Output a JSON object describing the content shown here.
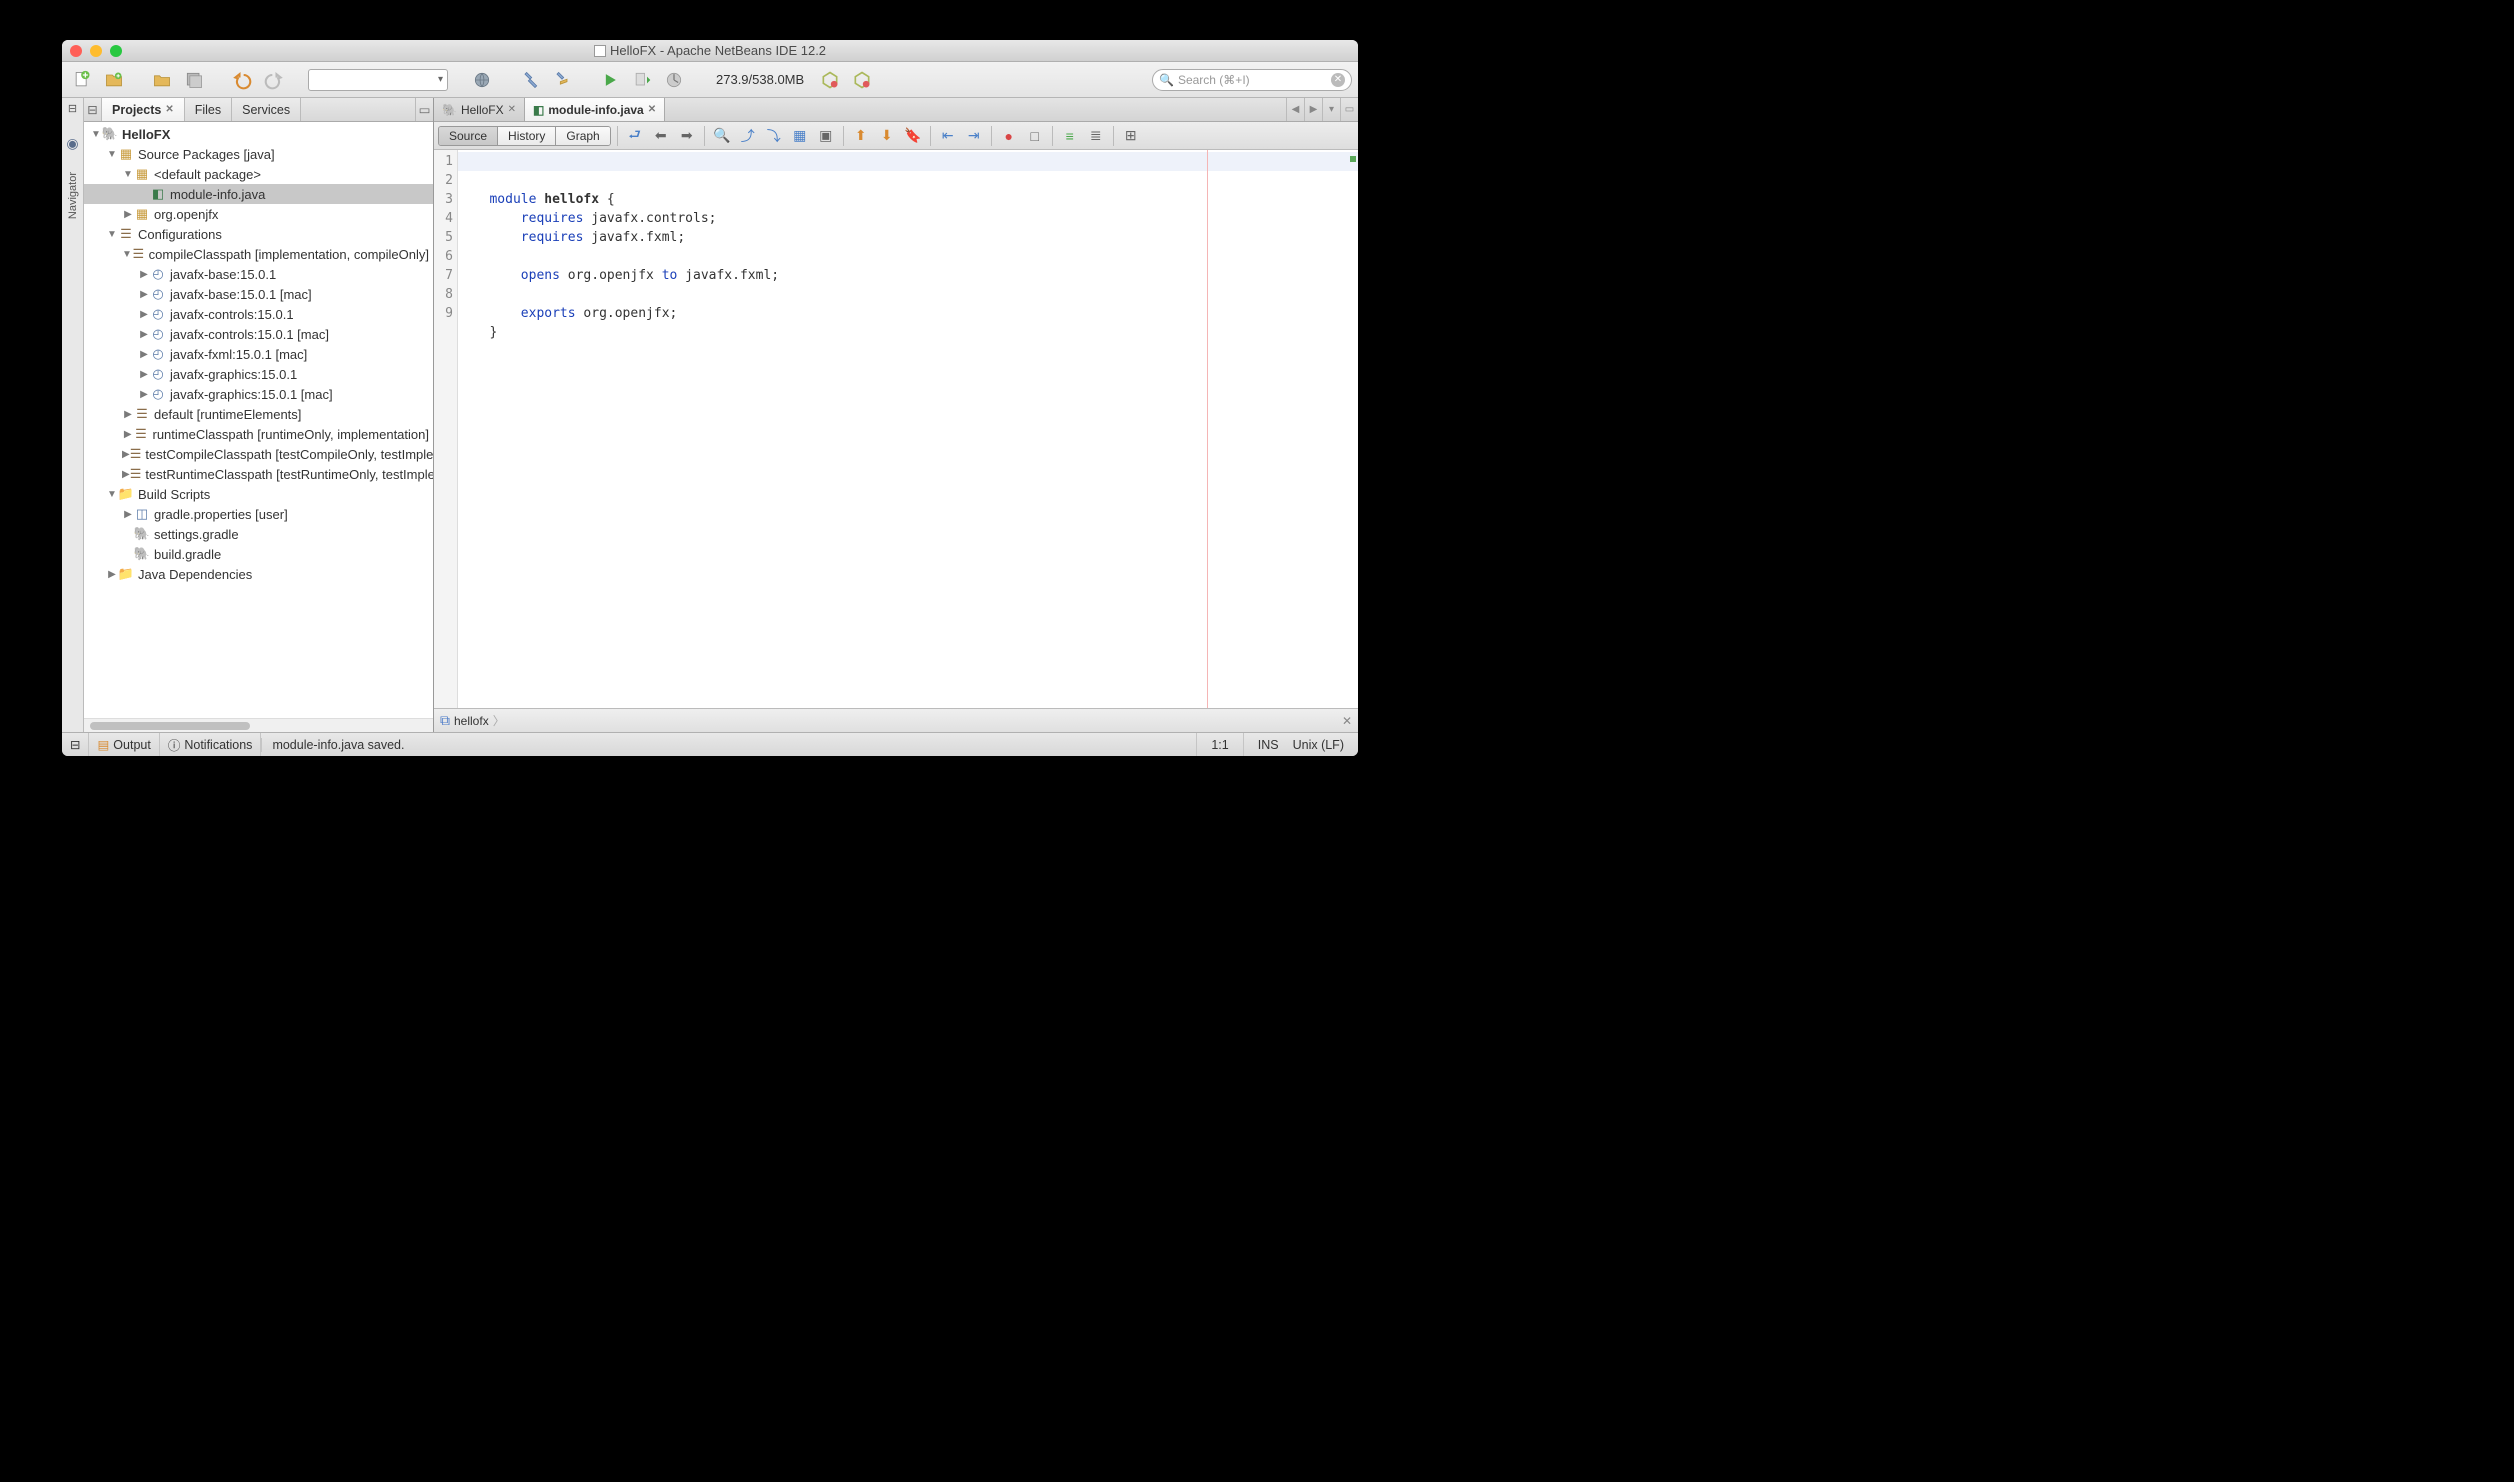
{
  "title": "HelloFX - Apache NetBeans IDE 12.2",
  "memory": "273.9/538.0MB",
  "search_placeholder": "Search (⌘+I)",
  "navside": "Navigator",
  "left_tabs": {
    "projects": "Projects",
    "files": "Files",
    "services": "Services"
  },
  "tree": {
    "root": "HelloFX",
    "source_packages": "Source Packages [java]",
    "default_pkg": "<default package>",
    "module_info": "module-info.java",
    "org_openjfx": "org.openjfx",
    "configurations": "Configurations",
    "compile_cp": "compileClasspath [implementation, compileOnly]",
    "jars": [
      "javafx-base:15.0.1",
      "javafx-base:15.0.1 [mac]",
      "javafx-controls:15.0.1",
      "javafx-controls:15.0.1 [mac]",
      "javafx-fxml:15.0.1 [mac]",
      "javafx-graphics:15.0.1",
      "javafx-graphics:15.0.1 [mac]"
    ],
    "default_cfg": "default [runtimeElements]",
    "runtime_cp": "runtimeClasspath [runtimeOnly, implementation]",
    "test_compile": "testCompileClasspath [testCompileOnly, testImplementation]",
    "test_runtime": "testRuntimeClasspath [testRuntimeOnly, testImplementation]",
    "build_scripts": "Build Scripts",
    "gradle_props": "gradle.properties [user]",
    "settings_gradle": "settings.gradle",
    "build_gradle": "build.gradle",
    "java_deps": "Java Dependencies"
  },
  "editor": {
    "tab1": "HelloFX",
    "tab2": "module-info.java",
    "views": {
      "source": "Source",
      "history": "History",
      "graph": "Graph"
    },
    "lines": [
      "1",
      "2",
      "3",
      "4",
      "5",
      "6",
      "7",
      "8",
      "9"
    ],
    "code": {
      "l1a": "module ",
      "l1b": "hellofx ",
      "l1c": "{",
      "l2a": "requires ",
      "l2b": "javafx.controls;",
      "l3a": "requires ",
      "l3b": "javafx.fxml;",
      "l5a": "opens ",
      "l5b": "org.openjfx ",
      "l5c": "to ",
      "l5d": "javafx.fxml;",
      "l7a": "exports ",
      "l7b": "org.openjfx;",
      "l8": "}"
    },
    "breadcrumb": "hellofx"
  },
  "status": {
    "output": "Output",
    "notifications": "Notifications",
    "message": "module-info.java saved.",
    "cursor": "1:1",
    "mode": "INS",
    "eol": "Unix (LF)"
  }
}
